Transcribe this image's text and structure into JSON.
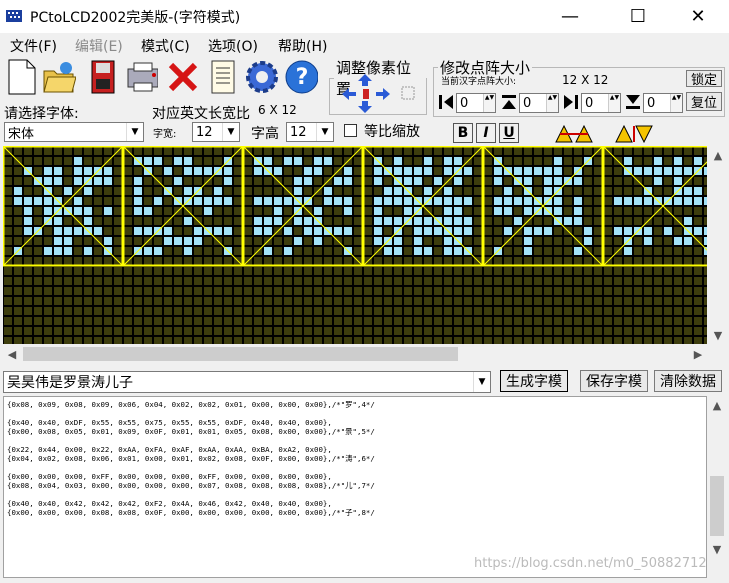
{
  "window": {
    "title": "PCtoLCD2002完美版-(字符模式)",
    "minimize_glyph": "—",
    "maximize_glyph": "☐",
    "close_glyph": "✕"
  },
  "menu": [
    {
      "label": "文件(F)",
      "enabled": true
    },
    {
      "label": "编辑(E)",
      "enabled": false
    },
    {
      "label": "模式(C)",
      "enabled": true
    },
    {
      "label": "选项(O)",
      "enabled": true
    },
    {
      "label": "帮助(H)",
      "enabled": true
    }
  ],
  "toolbar": {
    "icons": [
      "new-file-icon",
      "open-folder-icon",
      "save-disk-icon",
      "print-icon",
      "delete-x-icon",
      "notes-icon",
      "settings-gear-icon",
      "help-icon"
    ]
  },
  "adjust_group": {
    "legend": "调整像素位置"
  },
  "resize_group": {
    "legend": "修改点阵大小",
    "current_size_label": "当前汉字点阵大小:",
    "current_size_value": "12 X 12",
    "lock_button": "锁定",
    "reset_button": "复位",
    "spinners": [
      "0",
      "0",
      "0",
      "0"
    ]
  },
  "font_panel": {
    "choose_font_label": "请选择字体:",
    "english_ratio_label": "对应英文长宽比",
    "english_ratio_value": "6 X 12",
    "font_value": "宋体",
    "width_label": "字宽:",
    "width_value": "12",
    "height_label": "字高",
    "height_value": "12",
    "proportional_label": "等比缩放",
    "bold_label": "B",
    "italic_label": "I",
    "underline_label": "U"
  },
  "input_row": {
    "text_value": "吴昊伟是罗景涛儿子",
    "generate_button": "生成字模",
    "save_button": "保存字模",
    "clear_button": "清除数据"
  },
  "code_lines": [
    "{0x08, 0x09, 0x08, 0x09, 0x06, 0x04, 0x02, 0x02, 0x01, 0x00, 0x00, 0x00},/*\"罗\",4*/",
    "",
    "{0x40, 0x40, 0xDF, 0x55, 0x55, 0x75, 0x55, 0x55, 0xDF, 0x40, 0x40, 0x00},",
    "{0x00, 0x08, 0x05, 0x01, 0x09, 0x0F, 0x01, 0x01, 0x05, 0x08, 0x00, 0x00},/*\"景\",5*/",
    "",
    "{0x22, 0x44, 0x00, 0x22, 0xAA, 0xFA, 0xAF, 0xAA, 0xAA, 0xBA, 0xA2, 0x00},",
    "{0x04, 0x02, 0x08, 0x06, 0x01, 0x00, 0x01, 0x02, 0x08, 0x0F, 0x00, 0x00},/*\"涛\",6*/",
    "",
    "{0x00, 0x00, 0x00, 0xFF, 0x00, 0x00, 0x00, 0xFF, 0x00, 0x00, 0x00, 0x00},",
    "{0x08, 0x04, 0x03, 0x00, 0x00, 0x00, 0x00, 0x07, 0x08, 0x08, 0x08, 0x08},/*\"儿\",7*/",
    "",
    "{0x40, 0x40, 0x42, 0x42, 0x42, 0xF2, 0x4A, 0x46, 0x42, 0x40, 0x40, 0x00},",
    "{0x00, 0x00, 0x00, 0x08, 0x08, 0x0F, 0x00, 0x00, 0x00, 0x00, 0x00, 0x00},/*\"子\",8*/"
  ],
  "watermark": "https://blog.csdn.net/m0_50882712",
  "colors": {
    "pixel_on": "#a3e3f8",
    "pixel_off": "#3d3d0d",
    "grid_line": "#000000",
    "cell_border": "#ffff00"
  },
  "glyph_strip": {
    "cells": 6,
    "rows": 24,
    "cols": 72,
    "lit_columns_pattern": [
      "吴",
      "昊",
      "伟",
      "是",
      "罗",
      "景"
    ]
  }
}
